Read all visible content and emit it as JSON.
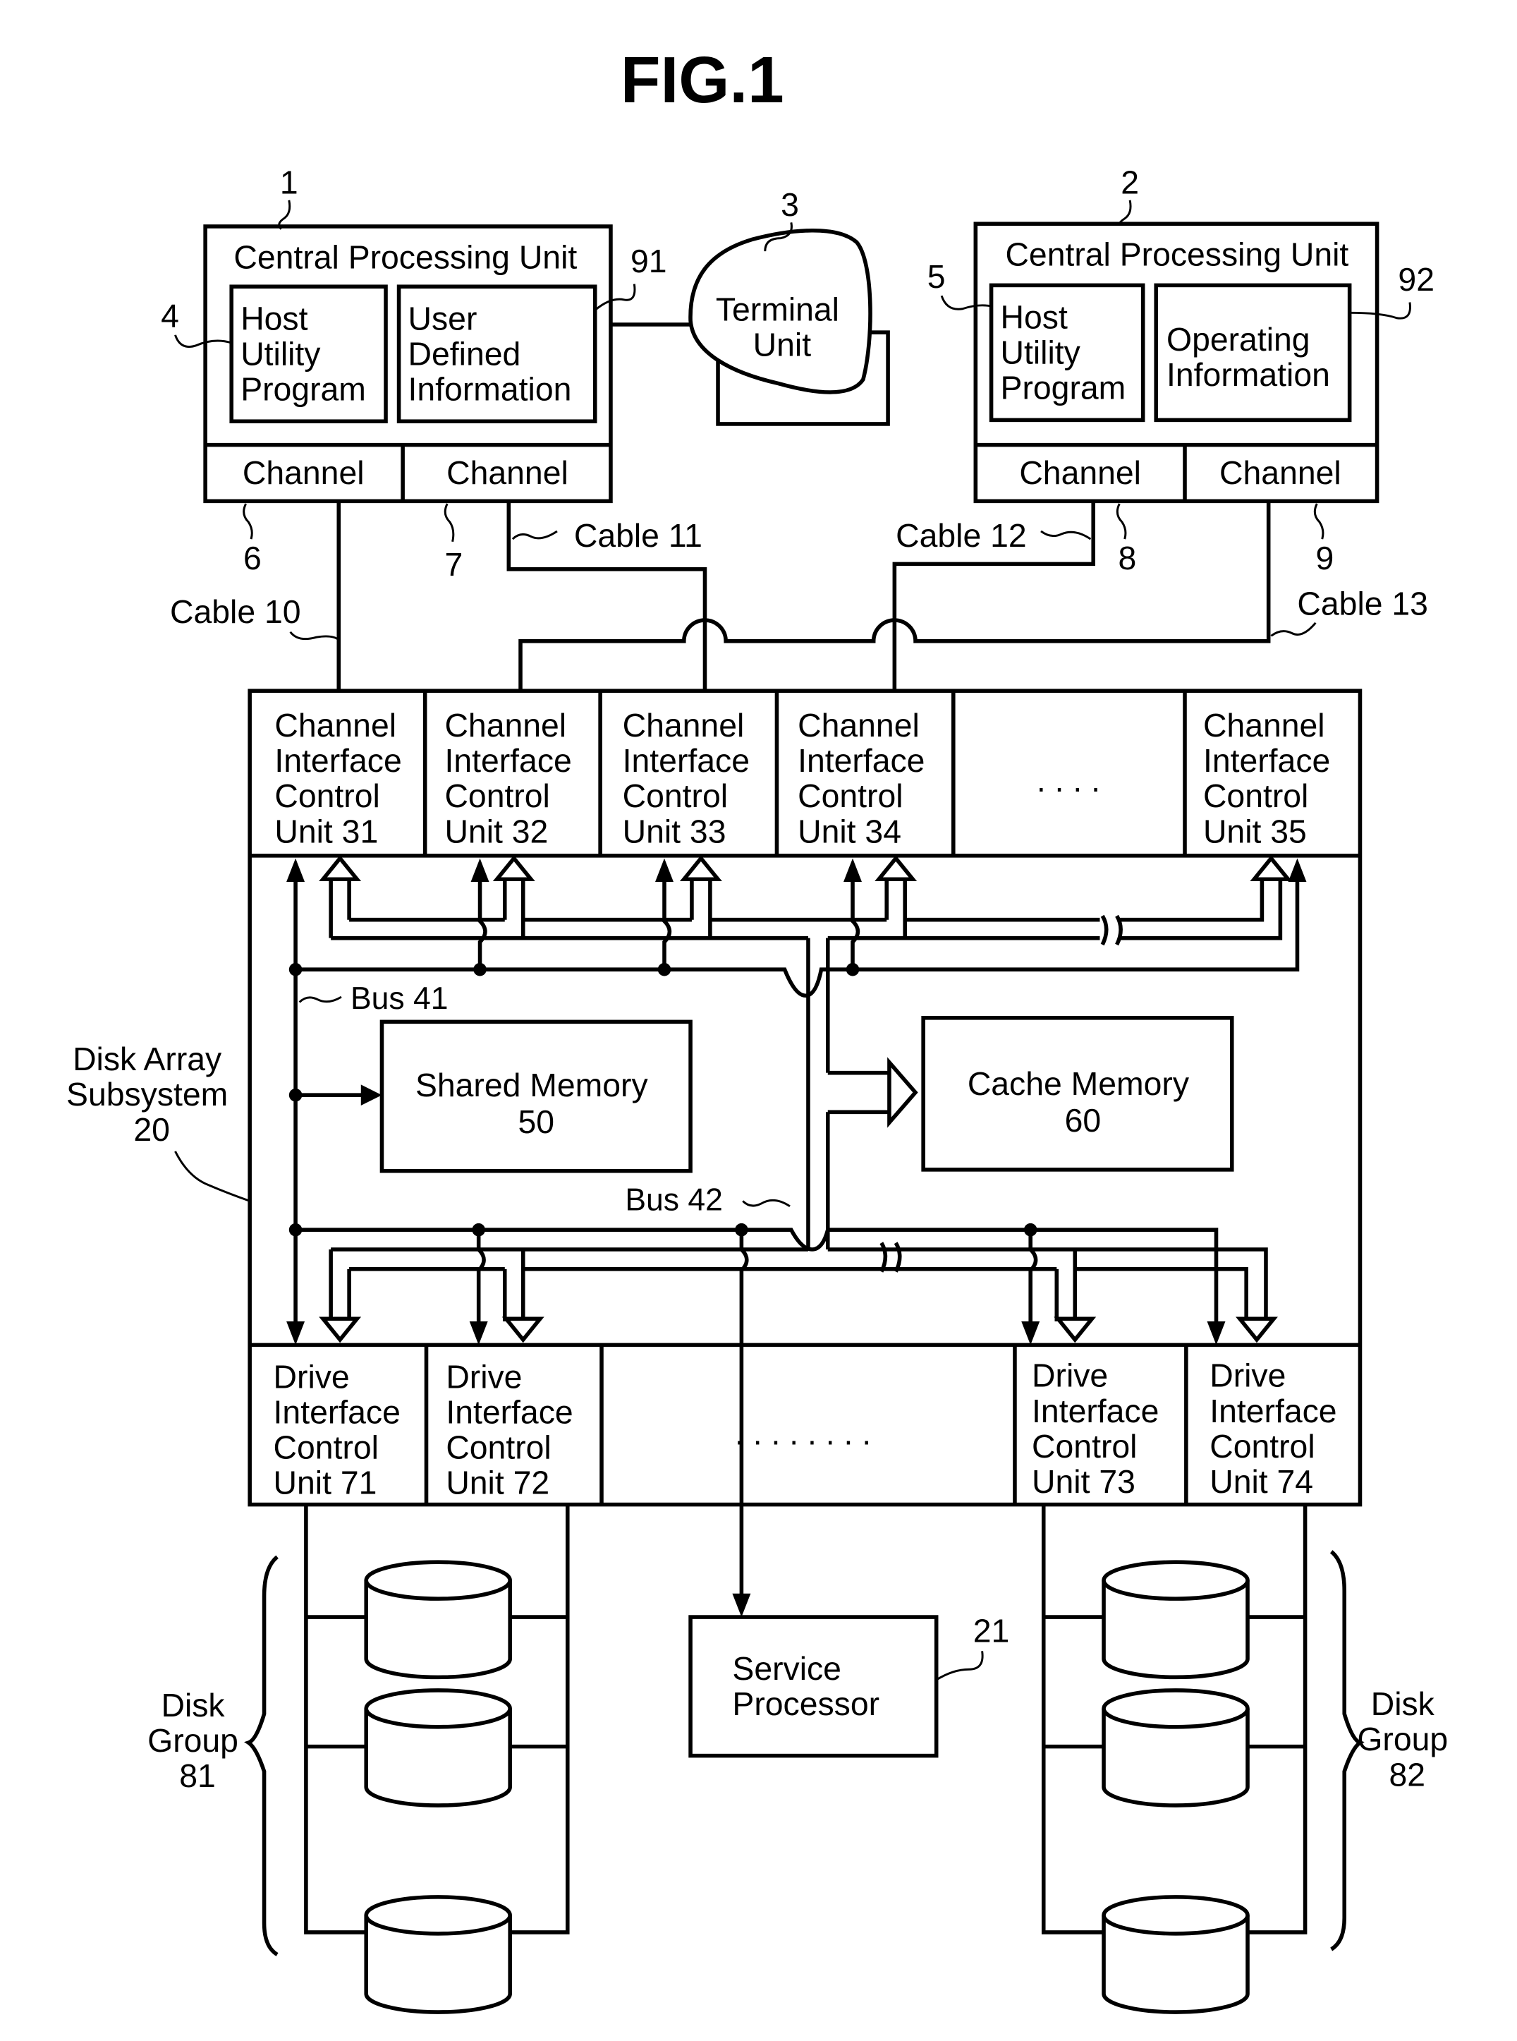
{
  "figure": {
    "title": "FIG.1"
  },
  "hosts": [
    {
      "ref": "1",
      "title": "Central Processing Unit",
      "program": {
        "ref": "4",
        "lines": [
          "Host",
          "Utility",
          "Program"
        ]
      },
      "info": {
        "ref": "91",
        "lines": [
          "User",
          "Defined",
          "Information"
        ]
      },
      "channels": [
        {
          "label": "Channel",
          "ref": "6"
        },
        {
          "label": "Channel",
          "ref": "7"
        }
      ]
    },
    {
      "ref": "2",
      "title": "Central Processing Unit",
      "program": {
        "ref": "5",
        "lines": [
          "Host",
          "Utility",
          "Program"
        ]
      },
      "info": {
        "ref": "92",
        "lines": [
          "Operating",
          "Information"
        ]
      },
      "channels": [
        {
          "label": "Channel",
          "ref": "8"
        },
        {
          "label": "Channel",
          "ref": "9"
        }
      ]
    }
  ],
  "terminal": {
    "ref": "3",
    "lines": [
      "Terminal",
      "Unit"
    ]
  },
  "cables": [
    "Cable 10",
    "Cable 11",
    "Cable 12",
    "Cable 13"
  ],
  "subsystem": {
    "lines": [
      "Disk Array",
      "Subsystem",
      "20"
    ]
  },
  "channel_units": [
    {
      "lines": [
        "Channel",
        "Interface",
        "Control",
        "Unit 31"
      ]
    },
    {
      "lines": [
        "Channel",
        "Interface",
        "Control",
        "Unit 32"
      ]
    },
    {
      "lines": [
        "Channel",
        "Interface",
        "Control",
        "Unit 33"
      ]
    },
    {
      "lines": [
        "Channel",
        "Interface",
        "Control",
        "Unit 34"
      ]
    },
    {
      "lines": [
        "Channel",
        "Interface",
        "Control",
        "Unit 35"
      ]
    }
  ],
  "channel_ellipsis": ". . . .",
  "buses": {
    "bus41": "Bus 41",
    "bus42": "Bus 42"
  },
  "shared_memory": {
    "lines": [
      "Shared Memory",
      "50"
    ]
  },
  "cache_memory": {
    "lines": [
      "Cache Memory",
      "60"
    ]
  },
  "drive_units": [
    {
      "lines": [
        "Drive",
        "Interface",
        "Control",
        "Unit 71"
      ]
    },
    {
      "lines": [
        "Drive",
        "Interface",
        "Control",
        "Unit 72"
      ]
    },
    {
      "lines": [
        "Drive",
        "Interface",
        "Control",
        "Unit 73"
      ]
    },
    {
      "lines": [
        "Drive",
        "Interface",
        "Control",
        "Unit 74"
      ]
    }
  ],
  "drive_ellipsis": ". . . . . . . .",
  "service_processor": {
    "ref": "21",
    "lines": [
      "Service",
      "Processor"
    ]
  },
  "disk_groups": [
    {
      "lines": [
        "Disk",
        "Group",
        "81"
      ]
    },
    {
      "lines": [
        "Disk",
        "Group",
        "82"
      ]
    }
  ]
}
